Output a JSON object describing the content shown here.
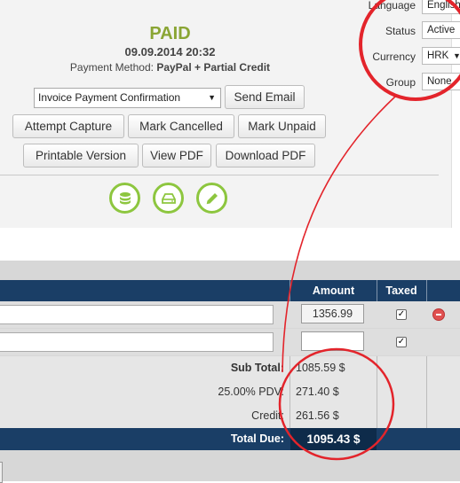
{
  "invoice": {
    "status": "PAID",
    "datetime": "09.09.2014 20:32",
    "payment_method_label": "Payment Method:",
    "payment_method_value": "PayPal + Partial Credit"
  },
  "actions": {
    "email_template_selected": "Invoice Payment Confirmation",
    "send_email": "Send Email",
    "attempt_capture": "Attempt Capture",
    "mark_cancelled": "Mark Cancelled",
    "mark_unpaid": "Mark Unpaid",
    "printable_version": "Printable Version",
    "view_pdf": "View PDF",
    "download_pdf": "Download PDF"
  },
  "icons": {
    "database": "database-icon",
    "drive": "hard-drive-icon",
    "edit": "pencil-icon"
  },
  "settings": {
    "language_label": "Language",
    "language_value": "English",
    "status_label": "Status",
    "status_value": "Active",
    "currency_label": "Currency",
    "currency_value": "HRK",
    "group_label": "Group",
    "group_value": "None"
  },
  "items_table": {
    "col_amount": "Amount",
    "col_taxed": "Taxed",
    "rows": [
      {
        "description": "",
        "amount": "1356.99",
        "taxed": true
      },
      {
        "description": "",
        "amount": "",
        "taxed": true
      }
    ]
  },
  "totals": {
    "sub_total_label": "Sub Total:",
    "sub_total_value": "1085.59 $",
    "tax_label": "25.00% PDV:",
    "tax_value": "271.40 $",
    "credit_label": "Credit:",
    "credit_value": "261.56 $",
    "total_due_label": "Total Due:",
    "total_due_value": "1095.43 $"
  },
  "colors": {
    "paid_green": "#8aa534",
    "header_navy": "#1a3e66",
    "icon_green": "#8dc63f",
    "annotation_red": "#e3242b"
  }
}
